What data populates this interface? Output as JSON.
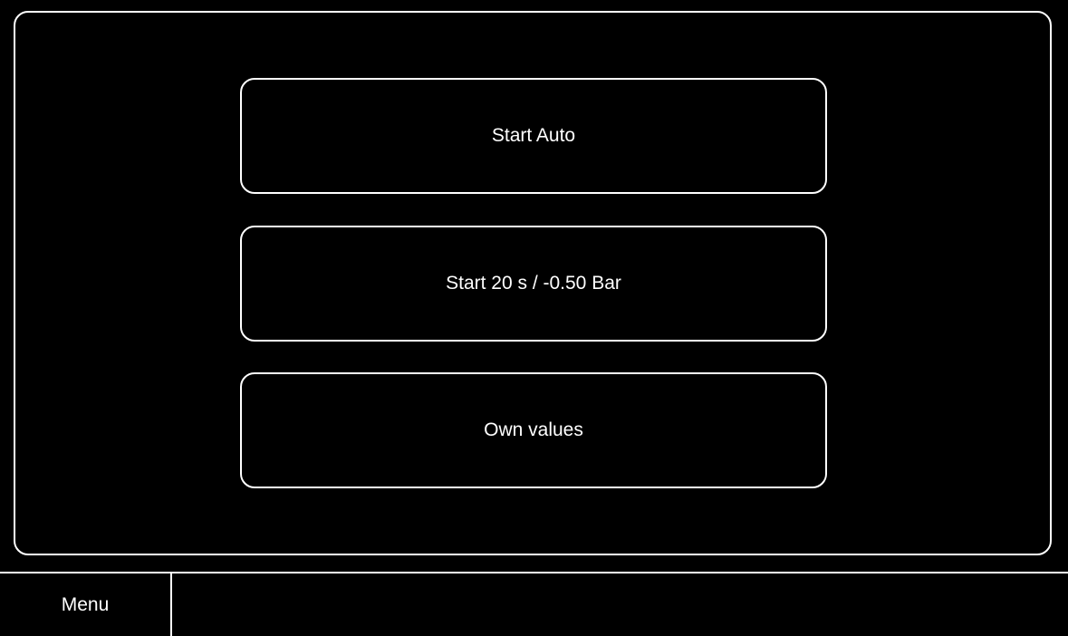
{
  "colors": {
    "background": "#000000",
    "foreground": "#ffffff"
  },
  "main": {
    "buttons": [
      {
        "label": "Start Auto"
      },
      {
        "label": "Start 20 s / -0.50 Bar"
      },
      {
        "label": "Own values"
      }
    ]
  },
  "footer": {
    "menu_label": "Menu"
  }
}
